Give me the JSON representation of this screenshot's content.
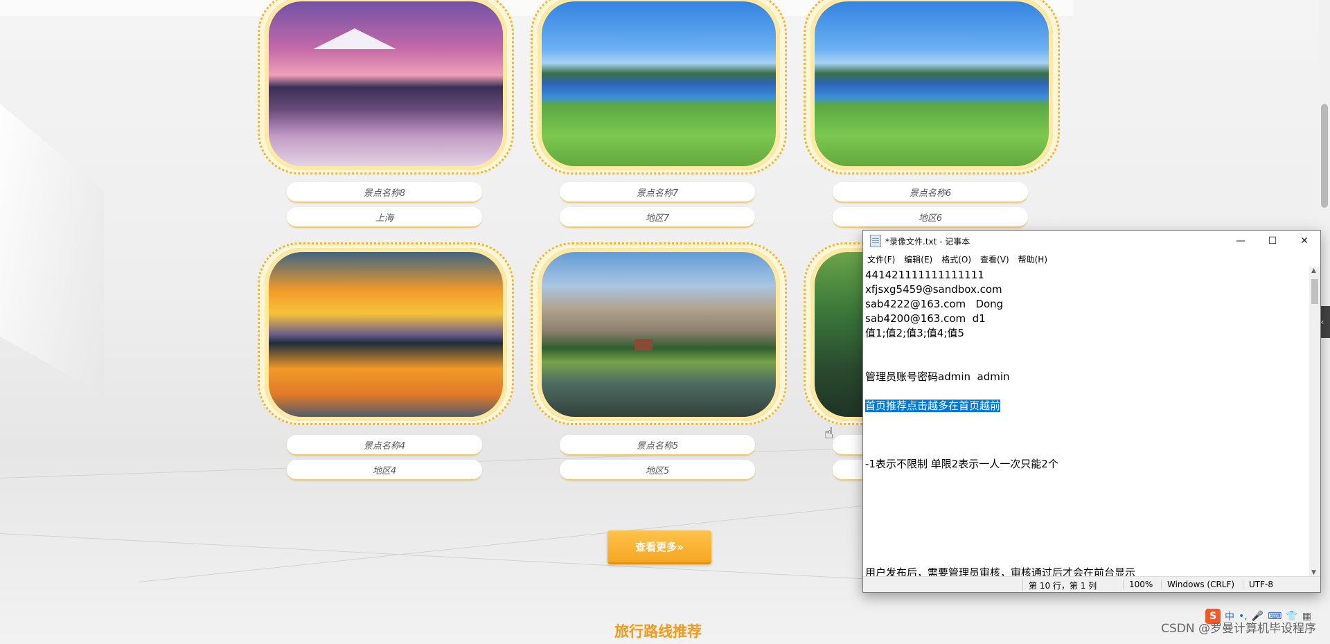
{
  "cards": [
    {
      "name": "景点名称8",
      "region": "上海"
    },
    {
      "name": "景点名称7",
      "region": "地区7"
    },
    {
      "name": "景点名称6",
      "region": "地区6"
    },
    {
      "name": "景点名称4",
      "region": "地区4"
    },
    {
      "name": "景点名称5",
      "region": "地区5"
    }
  ],
  "more_button": "查看更多»",
  "section_title": "旅行路线推荐",
  "watermark": "CSDN @罗曼计算机毕设程序",
  "notepad": {
    "title": "*录像文件.txt - 记事本",
    "menu": [
      "文件(F)",
      "编辑(E)",
      "格式(O)",
      "查看(V)",
      "帮助(H)"
    ],
    "controls": {
      "minimize": "—",
      "maximize": "☐",
      "close": "✕"
    },
    "lines": [
      "441421111111111111",
      "xfjsxg5459@sandbox.com",
      "sab4222@163.com   Dong",
      "sab4200@163.com  d1",
      "值1;值2;值3;值4;值5",
      "",
      "",
      "管理员账号密码admin  admin",
      "",
      "首页推荐点击越多在首页越前",
      "",
      "",
      "",
      "-1表示不限制 单限2表示一人一次只能2个"
    ],
    "selected_line_index": 9,
    "cut_line": "用户发布后，需要管理员审核，审核通过后才会在前台显示",
    "status": {
      "position": "第 10 行，第 1 列",
      "zoom": "100%",
      "line_ending": "Windows (CRLF)",
      "encoding": "UTF-8"
    }
  },
  "ime": {
    "logo": "S",
    "mode": "中",
    "punct": "•,"
  }
}
